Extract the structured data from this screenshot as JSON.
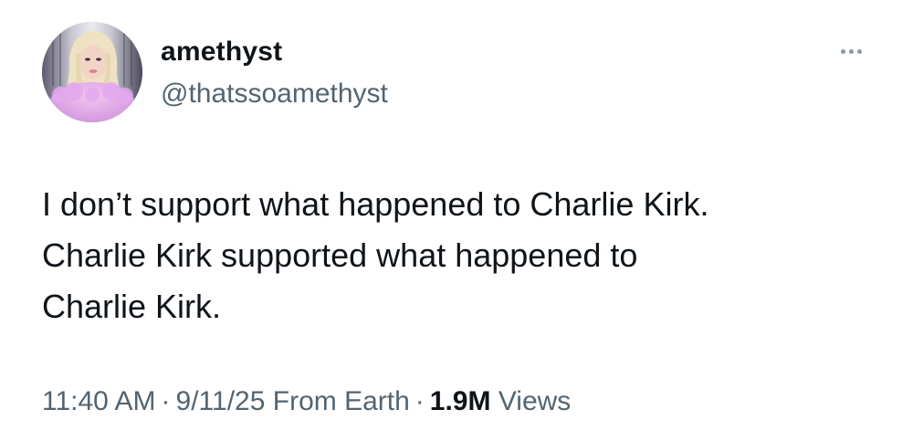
{
  "author": {
    "display_name": "amethyst",
    "handle": "@thatssoamethyst",
    "avatar_icon": "profile-photo"
  },
  "more_icon": "more-options-icon",
  "tweet": {
    "lines": [
      "I don’t support what happened to Charlie Kirk.",
      "Charlie Kirk supported what happened to",
      "Charlie Kirk."
    ]
  },
  "meta": {
    "time": "11:40 AM",
    "separator": "·",
    "date": "9/11/25",
    "location": "From Earth",
    "views_count": "1.9M",
    "views_label": "Views"
  },
  "colors": {
    "text": "#0f1419",
    "secondary": "#536471",
    "background": "#ffffff"
  }
}
